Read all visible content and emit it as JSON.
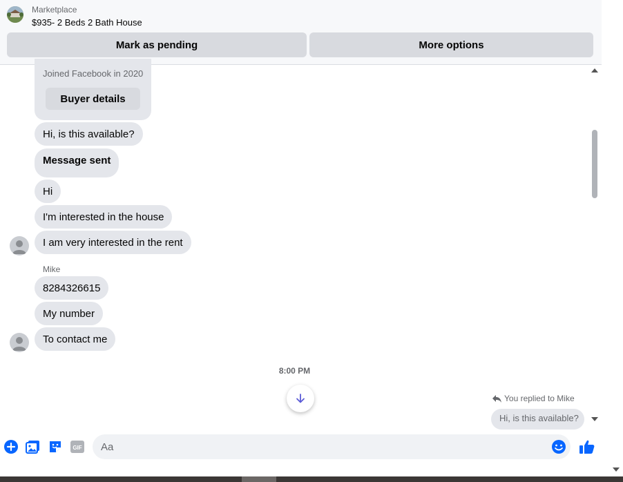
{
  "header": {
    "subtitle": "Marketplace",
    "title": "$935- 2 Beds 2 Bath House",
    "pending_label": "Mark as pending",
    "more_label": "More options"
  },
  "buyer_card": {
    "joined": "Joined Facebook in 2020",
    "details_label": "Buyer details"
  },
  "messages": [
    {
      "text": "Hi, is this available?"
    },
    {
      "text": "Message sent"
    },
    {
      "text": "Hi"
    },
    {
      "text": "I'm interested in the house"
    },
    {
      "text": "I am very interested in the rent"
    },
    {
      "text": "8284326615"
    },
    {
      "text": "My number"
    },
    {
      "text": "To contact me"
    }
  ],
  "sender_name": "Mike",
  "timestamp": "8:00 PM",
  "reply": {
    "label": "You replied to Mike",
    "quoted": "Hi, is this available?"
  },
  "composer": {
    "placeholder": "Aa"
  },
  "colors": {
    "accent": "#0866ff",
    "bubble": "#e4e6eb",
    "button": "#d8dadf",
    "muted_text": "#65676b"
  },
  "icons": [
    "plus-circle-icon",
    "photo-icon",
    "sticker-icon",
    "gif-icon",
    "emoji-icon",
    "thumbs-up-icon",
    "arrow-down-icon",
    "reply-icon",
    "user-avatar-icon"
  ]
}
